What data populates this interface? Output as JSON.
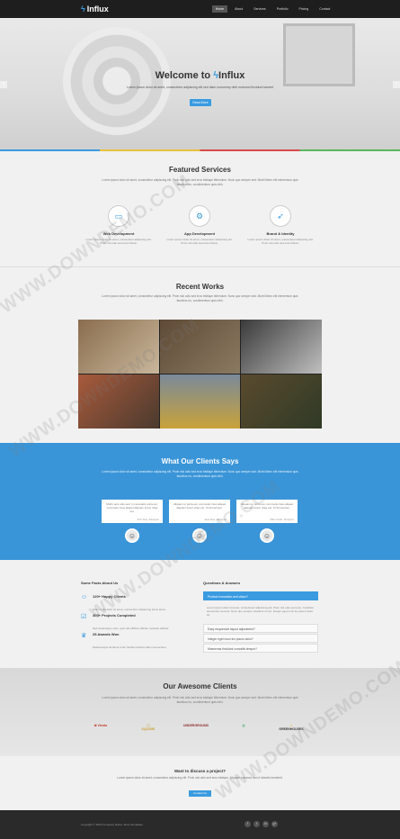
{
  "brand": {
    "name": "Influx"
  },
  "nav": {
    "items": [
      "Home",
      "About",
      "Services",
      "Portfolio",
      "Pricing",
      "Contact"
    ]
  },
  "hero": {
    "title_prefix": "Welcome to",
    "title_brand": "Influx",
    "subtitle": "Lorem ipsum dolor sit amet, consectetur adipiscing elit sed diam nonummy nibh euismod tincidunt laoreet",
    "button": "Read More"
  },
  "services": {
    "title": "Featured Services",
    "subtitle": "Lorem ipsum dolor sit amet, consectetur adipiscing elit. Proin nisi odio sed eros tristique bibendum. Nunc quo semper sed. Morbi libero elit elementum quis faucibus eu, condimentum quis nibh.",
    "items": [
      {
        "title": "Web Development",
        "text": "Lorem ipsum dolor sit amet, consectetur adipiscing elit. Proin nisi odio sed eros finibus.",
        "icon": "monitor-icon"
      },
      {
        "title": "App Development",
        "text": "Lorem ipsum dolor sit amet, consectetur adipiscing elit. Proin nisi odio sed eros finibus.",
        "icon": "gears-icon"
      },
      {
        "title": "Brand & Identity",
        "text": "Lorem ipsum dolor sit amet, consectetur adipiscing elit. Proin nisi odio sed eros finibus.",
        "icon": "rocket-icon"
      }
    ]
  },
  "works": {
    "title": "Recent Works",
    "subtitle": "Lorem ipsum dolor sit amet, consectetur adipiscing elit. Proin nisi odio sed eros tristique bibendum. Nunc quo semper sed. Morbi libero elit elementum quis faucibus eu, condimentum quis nibh."
  },
  "testimonials": {
    "title": "What Our Clients Says",
    "subtitle": "Lorem ipsum dolor sit amet, consectetur adipiscing elit. Proin nisi odio sed eros tristique bibendum. Nunc quo semper sed. Morbi libero elit elementum quis faucibus eu, condimentum quis nibh.",
    "items": [
      {
        "text": "Morbi quis odio sed. In venenatis porta est, commodo risus aliquet aliquam lorem vitae est.",
        "by": "John Doe, Designer"
      },
      {
        "text": "Aliquam ut porta est, commodo risus aliquet aliquam lorem vitae est. Ut fermentum.",
        "by": "Jane Roe, Designer"
      },
      {
        "text": "Aliquam ut porta est, commodo risus aliquet aliquam lorem vitae est. Ut fermentum.",
        "by": "Mike Smith, Designer"
      }
    ]
  },
  "facts": {
    "title": "Some Facts About Us",
    "items": [
      {
        "title": "120+ Happy Clients",
        "text": "Etiam nulla dolor sit amet, consectetur adipiscing elit at lacus."
      },
      {
        "title": "300+ Projects Completed",
        "text": "Sed scelerisque nunc, quis nisl efficitur efficitur molestie efficitur."
      },
      {
        "title": "25 Awards Won",
        "text": "Pellentesque tincidunt tortor facilisis facilisis diam consectetur."
      }
    ]
  },
  "qa": {
    "title": "Questions & Answers",
    "items": [
      "Product innovation and vision?",
      "Easy responsive layout adjustment?",
      "Integer eget nunc leo ipsum dolor?",
      "Maecenas tincidunt convallis tempor?"
    ],
    "answer": "Lorem ipsum dolor sit amet, consectetur adipiscing elit. Proin nisi odio sed eros. Curabitur elementum sed est. Nunc quo semper, faucibus ut nisi. Integer eget nunc leo ipsum dolor sit."
  },
  "clients": {
    "title": "Our Awesome Clients",
    "subtitle": "Lorem ipsum dolor sit amet, consectetur adipiscing elit. Proin nisi odio sed eros tristique bibendum. Nunc quo semper sed. Morbi libero elit elementum quis faucibus eu, condimentum quis nibh.",
    "logos": [
      "Viento",
      "SQUARE",
      "UNDERGROUND",
      "",
      "GREENHOUSES"
    ]
  },
  "cta": {
    "title": "Want to discuss a project?",
    "text": "Lorem ipsum dolor sit amet, consectetur adipiscing elit. Proin nisi odio sed eros tristique. Aliquam euismod nisi ut lobortis hendrerit.",
    "button": "Contact Us"
  },
  "footer": {
    "copyright": "Copyright © 2016 Company Name. More Templates",
    "social": [
      "f",
      "t",
      "in",
      "g+"
    ]
  },
  "watermark": "WWW.DOWNDEMO.COM",
  "colors": {
    "accent": "#3a9be0",
    "dark": "#1e1e1e"
  }
}
